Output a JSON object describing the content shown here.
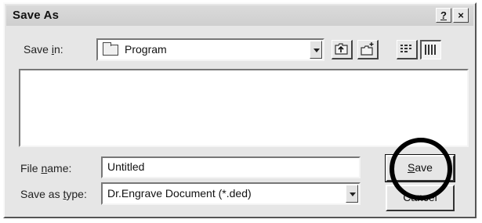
{
  "window": {
    "title": "Save As",
    "help_label": "?",
    "close_label": "×"
  },
  "save_in": {
    "label_pre": "Save ",
    "label_accel": "i",
    "label_post": "n:",
    "current_folder": "Program",
    "folder_icon": "folder-icon"
  },
  "toolbar": {
    "icons": [
      "up-one-level-icon",
      "create-new-folder-icon",
      "list-view-icon",
      "details-view-icon"
    ]
  },
  "file_list": {
    "items": []
  },
  "file_name": {
    "label_pre": "File ",
    "label_accel": "n",
    "label_post": "ame:",
    "value": "Untitled"
  },
  "save_as_type": {
    "label_pre": "Save as ",
    "label_accel": "t",
    "label_post": "ype:",
    "value": "Dr.Engrave Document (*.ded)"
  },
  "buttons": {
    "save_accel": "S",
    "save_rest": "ave",
    "cancel_label": "Cancel"
  }
}
